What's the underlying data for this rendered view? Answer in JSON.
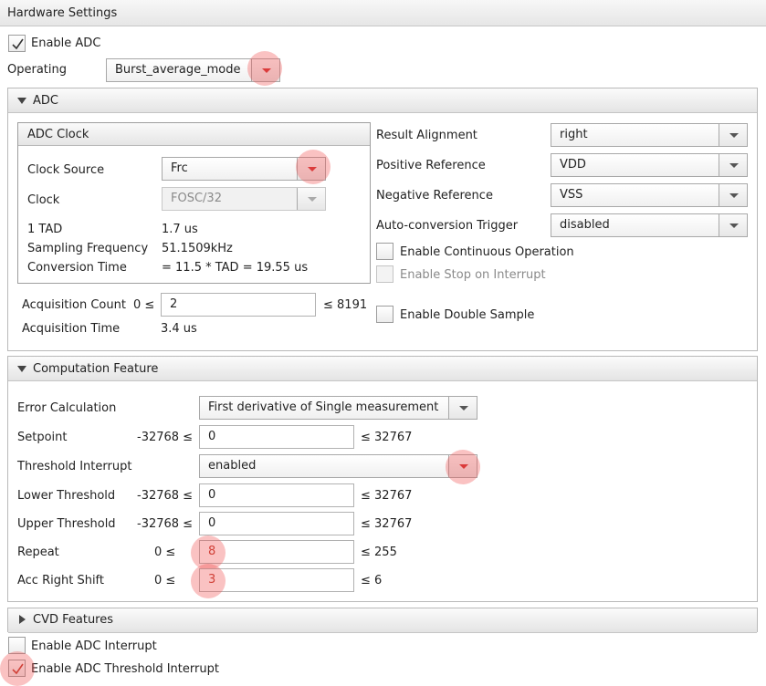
{
  "window": {
    "title": "Hardware Settings"
  },
  "top": {
    "enable_adc": {
      "label": "Enable ADC",
      "checked": true
    },
    "operating": {
      "label": "Operating",
      "value": "Burst_average_mode"
    }
  },
  "adc": {
    "title": "ADC",
    "clock_group": {
      "title": "ADC Clock",
      "clock_source": {
        "label": "Clock Source",
        "value": "Frc"
      },
      "clock": {
        "label": "Clock",
        "value": "FOSC/32"
      },
      "tad": {
        "label": "1 TAD",
        "value": "1.7 us"
      },
      "sampling": {
        "label": "Sampling Frequency",
        "value": "51.1509kHz"
      },
      "conversion": {
        "label": "Conversion Time",
        "value": "= 11.5 * TAD =  19.55 us"
      }
    },
    "acq_count": {
      "label": "Acquisition Count",
      "min": "0 ≤",
      "value": "2",
      "max": "≤ 8191"
    },
    "acq_time": {
      "label": "Acquisition Time",
      "value": "3.4 us"
    },
    "result_alignment": {
      "label": "Result Alignment",
      "value": "right"
    },
    "pos_ref": {
      "label": "Positive Reference",
      "value": "VDD"
    },
    "neg_ref": {
      "label": "Negative Reference",
      "value": "VSS"
    },
    "auto_trigger": {
      "label": "Auto-conversion Trigger",
      "value": "disabled"
    },
    "continuous": {
      "label": "Enable Continuous Operation",
      "checked": false
    },
    "stop_on_interrupt": {
      "label": "Enable Stop on Interrupt",
      "checked": false,
      "disabled": true
    },
    "double_sample": {
      "label": "Enable Double Sample",
      "checked": false
    }
  },
  "computation": {
    "title": "Computation Feature",
    "error_calc": {
      "label": "Error Calculation",
      "value": "First derivative of Single measurement"
    },
    "setpoint": {
      "label": "Setpoint",
      "min": "-32768 ≤",
      "value": "0",
      "max": "≤ 32767"
    },
    "threshold_interrupt": {
      "label": "Threshold Interrupt",
      "value": "enabled"
    },
    "lower_threshold": {
      "label": "Lower Threshold",
      "min": "-32768 ≤",
      "value": "0",
      "max": "≤ 32767"
    },
    "upper_threshold": {
      "label": "Upper Threshold",
      "min": "-32768 ≤",
      "value": "0",
      "max": "≤ 32767"
    },
    "repeat": {
      "label": "Repeat",
      "min": "0 ≤",
      "value": "8",
      "max": "≤ 255"
    },
    "acc_right_shift": {
      "label": "Acc Right Shift",
      "min": "0 ≤",
      "value": "3",
      "max": "≤ 6"
    }
  },
  "cvd": {
    "title": "CVD Features"
  },
  "bottom": {
    "adc_interrupt": {
      "label": "Enable ADC Interrupt",
      "checked": false
    },
    "adc_threshold_interrupt": {
      "label": "Enable ADC Threshold Interrupt",
      "checked": true
    }
  },
  "icons": {
    "check": "check-icon",
    "expanded": "triangle-down-icon",
    "collapsed": "triangle-right-icon",
    "dropdown": "chevron-down-icon"
  },
  "colors": {
    "highlight": "#f05050",
    "highlight_arrow": "#d03030",
    "panel_border": "#b9b9b9"
  }
}
